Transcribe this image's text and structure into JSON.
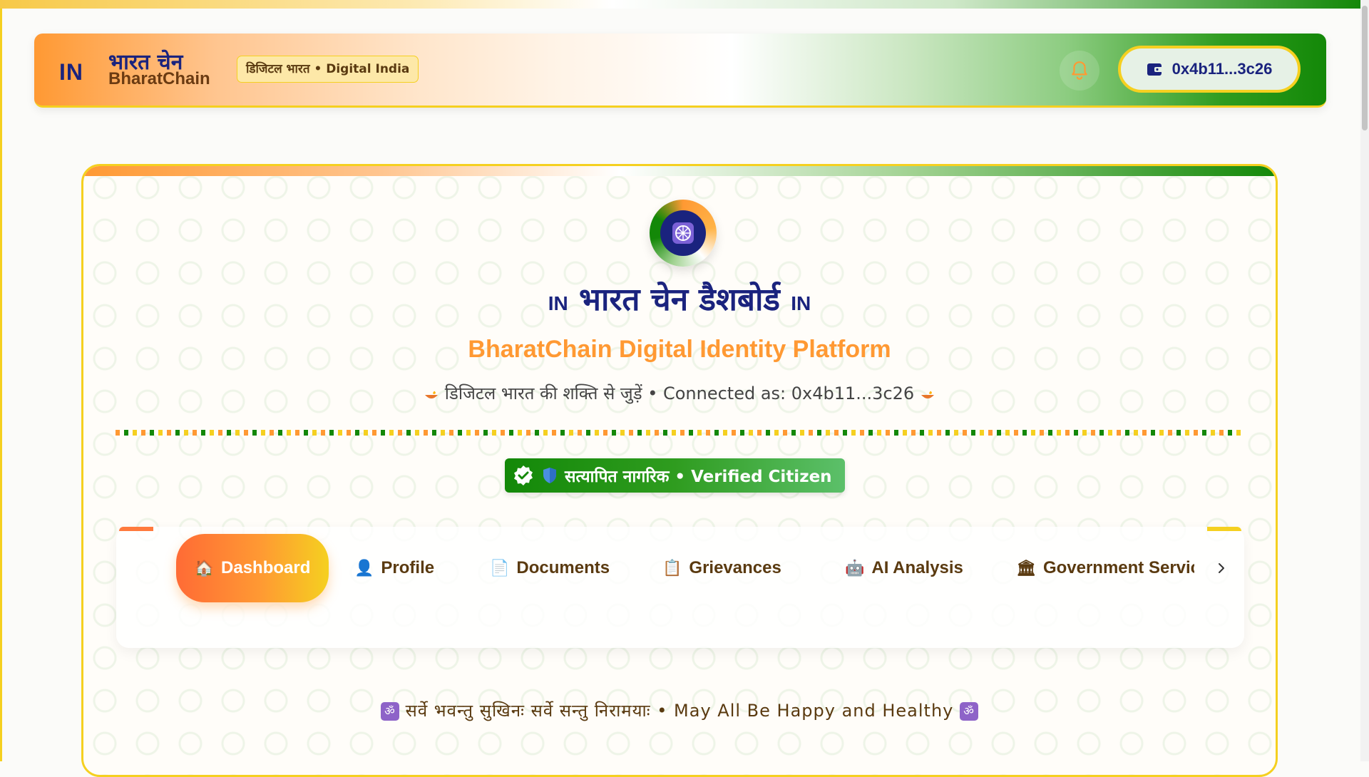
{
  "header": {
    "flag": "IN",
    "brand_hindi": "भारत चेन",
    "brand_en": "BharatChain",
    "badge": "डिजिटल भारत • Digital India",
    "wallet": "0x4b11...3c26"
  },
  "dashboard": {
    "flag_left": "IN",
    "title": "भारत चेन डैशबोर्ड",
    "flag_right": "IN",
    "subtitle": "BharatChain Digital Identity Platform",
    "tagline": "डिजिटल भारत की शक्ति से जुड़ें • Connected as: 0x4b11...3c26",
    "verified": "सत्यापित नागरिक • Verified Citizen"
  },
  "tabs": [
    {
      "label": "Dashboard",
      "icon": "home-icon",
      "active": true
    },
    {
      "label": "Profile",
      "icon": "person-icon"
    },
    {
      "label": "Documents",
      "icon": "document-icon"
    },
    {
      "label": "Grievances",
      "icon": "clipboard-icon"
    },
    {
      "label": "AI Analysis",
      "icon": "robot-icon"
    },
    {
      "label": "Government Services",
      "icon": "government-building-icon"
    }
  ],
  "motto": "सर्वे भवन्तु सुखिनः सर्वे सन्तु निरामयाः • May All Be Happy and Healthy",
  "colors": {
    "saffron": "#ff9933",
    "green": "#138808",
    "navy": "#1a237e",
    "gold": "#f5d020"
  }
}
